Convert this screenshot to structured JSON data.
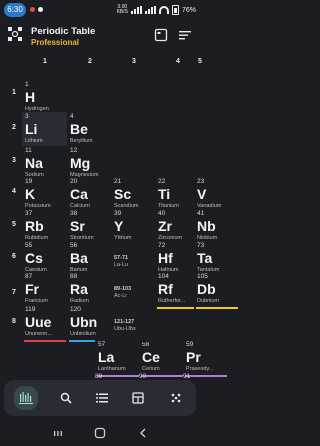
{
  "status_bar": {
    "time": "6:30",
    "dot_colors": [
      "#e64b4b",
      "#f2f2f2"
    ],
    "net_speed_value": "3.00",
    "net_speed_unit": "KB/S",
    "battery": "76%"
  },
  "app_bar": {
    "title": "Periodic Table",
    "subtitle": "Professional",
    "logo_icon": "atom-grid-icon",
    "actions": [
      "view-toggle-icon",
      "menu-icon"
    ]
  },
  "groups": [
    "1",
    "2",
    "3",
    "4",
    "5"
  ],
  "periods": [
    "1",
    "2",
    "3",
    "4",
    "5",
    "6",
    "7",
    "8"
  ],
  "elements": [
    {
      "num": "1",
      "sym": "H",
      "name": "Hydrogen",
      "bar_color": "#f5a623"
    },
    {
      "num": "3",
      "sym": "Li",
      "name": "Lithium",
      "bar_color": "#e04040"
    },
    {
      "num": "4",
      "sym": "Be",
      "name": "Beryllium",
      "bar_color": "#3aa0e8"
    },
    {
      "num": "11",
      "sym": "Na",
      "name": "Sodium",
      "bar_color": "#e04040"
    },
    {
      "num": "12",
      "sym": "Mg",
      "name": "Magnesium",
      "bar_color": "#3aa0e8"
    },
    {
      "num": "19",
      "sym": "K",
      "name": "Potassium",
      "bar_color": "#e04040"
    },
    {
      "num": "20",
      "sym": "Ca",
      "name": "Calcium",
      "bar_color": "#3aa0e8"
    },
    {
      "num": "21",
      "sym": "Sc",
      "name": "Scandium",
      "bar_color": "#f0d000"
    },
    {
      "num": "22",
      "sym": "Ti",
      "name": "Titanium",
      "bar_color": "#f0d000"
    },
    {
      "num": "23",
      "sym": "V",
      "name": "Vanadium",
      "bar_color": "#f0d000"
    },
    {
      "num": "37",
      "sym": "Rb",
      "name": "Rubidium",
      "bar_color": "#e04040"
    },
    {
      "num": "38",
      "sym": "Sr",
      "name": "Strontium",
      "bar_color": "#3aa0e8"
    },
    {
      "num": "39",
      "sym": "Y",
      "name": "Yttrium",
      "bar_color": "#f0d000"
    },
    {
      "num": "40",
      "sym": "Zr",
      "name": "Zirconium",
      "bar_color": "#f0d000"
    },
    {
      "num": "41",
      "sym": "Nb",
      "name": "Niobium",
      "bar_color": "#f0d000"
    },
    {
      "num": "55",
      "sym": "Cs",
      "name": "Caesium",
      "bar_color": "#e04040"
    },
    {
      "num": "56",
      "sym": "Ba",
      "name": "Barium",
      "bar_color": "#3aa0e8"
    },
    {
      "num": "72",
      "sym": "Hf",
      "name": "Hafnium",
      "bar_color": "#f0d000"
    },
    {
      "num": "73",
      "sym": "Ta",
      "name": "Tantalum",
      "bar_color": "#f0d000"
    },
    {
      "num": "87",
      "sym": "Fr",
      "name": "Francium",
      "bar_color": "#e04040"
    },
    {
      "num": "88",
      "sym": "Ra",
      "name": "Radium",
      "bar_color": "#3aa0e8"
    },
    {
      "num": "104",
      "sym": "Rf",
      "name": "Rutherfor...",
      "bar_color": "#f0d000"
    },
    {
      "num": "105",
      "sym": "Db",
      "name": "Dubnium",
      "bar_color": "#f0d000"
    },
    {
      "num": "119",
      "sym": "Uue",
      "name": "Ununenn...",
      "bar_color": "#e04040"
    },
    {
      "num": "120",
      "sym": "Ubn",
      "name": "Unbinilium",
      "bar_color": "#3aa0e8"
    },
    {
      "num": "57",
      "sym": "La",
      "name": "Lanthanum",
      "bar_color": "#b57ad8"
    },
    {
      "num": "58",
      "sym": "Ce",
      "name": "Cerium",
      "bar_color": "#b57ad8"
    },
    {
      "num": "59",
      "sym": "Pr",
      "name": "Praseody...",
      "bar_color": "#b57ad8"
    }
  ],
  "series_cells": [
    {
      "range": "57-71",
      "sub": "La-Lu",
      "bar_color": "#b57ad8"
    },
    {
      "range": "89-103",
      "sub": "Ac-Lr",
      "bar_color": "#6fb3ff"
    },
    {
      "range": "121-127",
      "sub": "Ubu-Ubs",
      "bar_color": ""
    }
  ],
  "bottom_row_numbers": [
    "89",
    "90",
    "91"
  ],
  "bottom_nav": {
    "items": [
      "spectrum-icon",
      "search-icon",
      "list-icon",
      "table-icon",
      "more-icon"
    ],
    "active": "spectrum-icon"
  },
  "system_nav": [
    "recents-icon",
    "home-icon",
    "back-icon"
  ]
}
